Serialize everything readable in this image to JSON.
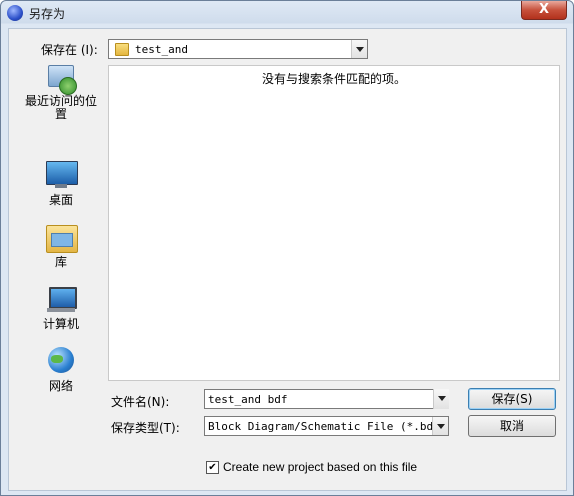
{
  "window": {
    "title": "另存为",
    "close_label": "X"
  },
  "save_in": {
    "label": "保存在 (I):",
    "value": "test_and"
  },
  "places": [
    {
      "label": "最近访问的位置",
      "icon": "recent-places-icon"
    },
    {
      "label": "桌面",
      "icon": "desktop-icon"
    },
    {
      "label": "库",
      "icon": "libraries-icon"
    },
    {
      "label": "计算机",
      "icon": "computer-icon"
    },
    {
      "label": "网络",
      "icon": "network-icon"
    }
  ],
  "file_list": {
    "empty_message": "没有与搜索条件匹配的项。"
  },
  "filename": {
    "label": "文件名(N):",
    "value": "test_and bdf"
  },
  "filetype": {
    "label": "保存类型(T):",
    "value": "Block Diagram/Schematic File (*.bdf)"
  },
  "buttons": {
    "save": "保存(S)",
    "cancel": "取消"
  },
  "checkbox": {
    "label": "Create new project based on this file",
    "checked": true,
    "mark": "✔"
  },
  "colors": {
    "close_button": "#c7513c",
    "title_bar": "#dfe9f5"
  }
}
